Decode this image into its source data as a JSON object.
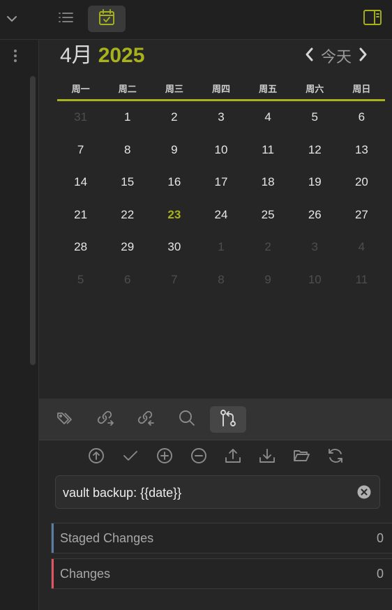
{
  "header": {
    "collapse_icon": "chevron-down-icon",
    "tabs": [
      {
        "name": "outline",
        "icon": "list-icon",
        "active": false
      },
      {
        "name": "calendar",
        "icon": "calendar-check-icon",
        "active": true
      }
    ],
    "right_icon": "sidebar-toggle-icon"
  },
  "gutter": {
    "menu_icon": "more-vertical-icon"
  },
  "calendar": {
    "month": "4月",
    "year": "2025",
    "today_label": "今天",
    "weekdays": [
      "周一",
      "周二",
      "周三",
      "周四",
      "周五",
      "周六",
      "周日"
    ],
    "weeks": [
      [
        {
          "d": "31",
          "dim": true
        },
        {
          "d": "1"
        },
        {
          "d": "2"
        },
        {
          "d": "3"
        },
        {
          "d": "4"
        },
        {
          "d": "5"
        },
        {
          "d": "6"
        }
      ],
      [
        {
          "d": "7"
        },
        {
          "d": "8"
        },
        {
          "d": "9"
        },
        {
          "d": "10"
        },
        {
          "d": "11"
        },
        {
          "d": "12"
        },
        {
          "d": "13"
        }
      ],
      [
        {
          "d": "14"
        },
        {
          "d": "15"
        },
        {
          "d": "16"
        },
        {
          "d": "17"
        },
        {
          "d": "18"
        },
        {
          "d": "19"
        },
        {
          "d": "20"
        }
      ],
      [
        {
          "d": "21"
        },
        {
          "d": "22"
        },
        {
          "d": "23",
          "today": true
        },
        {
          "d": "24"
        },
        {
          "d": "25"
        },
        {
          "d": "26"
        },
        {
          "d": "27"
        }
      ],
      [
        {
          "d": "28"
        },
        {
          "d": "29"
        },
        {
          "d": "30"
        },
        {
          "d": "1",
          "dim": true
        },
        {
          "d": "2",
          "dim": true
        },
        {
          "d": "3",
          "dim": true
        },
        {
          "d": "4",
          "dim": true
        }
      ],
      [
        {
          "d": "5",
          "dim": true
        },
        {
          "d": "6",
          "dim": true
        },
        {
          "d": "7",
          "dim": true
        },
        {
          "d": "8",
          "dim": true
        },
        {
          "d": "9",
          "dim": true
        },
        {
          "d": "10",
          "dim": true
        },
        {
          "d": "11",
          "dim": true
        }
      ]
    ]
  },
  "panel": {
    "tabs": [
      "tags-icon",
      "outgoing-links-icon",
      "backlinks-icon",
      "search-icon",
      "git-branch-icon"
    ],
    "active_tab": "git-branch-icon",
    "actions": [
      "push-icon",
      "commit-icon",
      "stage-all-icon",
      "unstage-all-icon",
      "upload-icon",
      "download-icon",
      "folder-open-icon",
      "refresh-icon"
    ],
    "commit_message": "vault backup: {{date}}",
    "staged_label": "Staged Changes",
    "staged_count": "0",
    "changes_label": "Changes",
    "changes_count": "0"
  },
  "colors": {
    "accent": "#a7b21c",
    "staged_bar": "#5b7da3",
    "changes_bar": "#e05561"
  }
}
